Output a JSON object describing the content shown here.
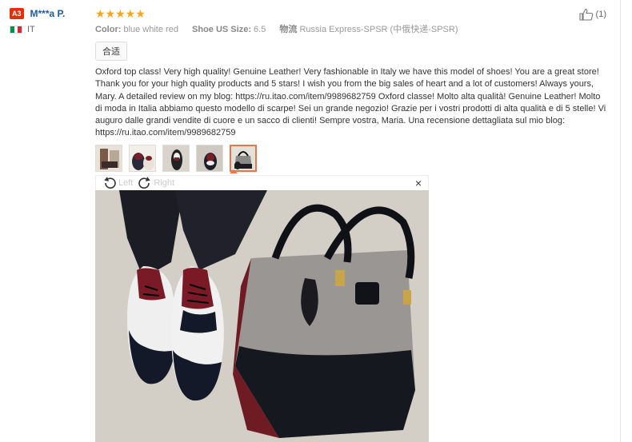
{
  "user": {
    "level_badge": "A3",
    "name": "M***a P.",
    "country": "IT"
  },
  "review": {
    "stars": "★★★★★",
    "color_label": "Color:",
    "color_value": "blue white red",
    "size_label": "Shoe US Size:",
    "size_value": "6.5",
    "shipping_label": "物流",
    "shipping_value": "Russia Express-SPSR (中俄快递-SPSR)",
    "tag": "合适",
    "text": "Oxford top class! Very high quality! Genuine Leather! Very fashionable in Italy we have this model of shoes! You are a great store! Thank you for your high quality products and 5 stars! I wish you from the big sales of heart and a lot of customers! Always yours, Mary. A detailed review on my blog: https://ru.itao.com/item/9989682759 Oxford classe! Molto alta qualità! Genuine Leather! Molto di moda in Italia abbiamo questo modello di scarpe! Sei un grande negozio! Grazie per i vostri prodotti di alta qualità e di 5 stelle! Vi auguro dalle grandi vendite di cuore e un sacco di clienti! Sempre vostra, Maria. Una recensione dettagliata sul mio blog: https://ru.itao.com/item/9989682759",
    "helpful_count": "(1)"
  },
  "viewer": {
    "rotate_left": "Left",
    "rotate_right": "Right",
    "close": "×"
  },
  "colors": {
    "badge_red": "#e62e04",
    "username_blue": "#1a5ba8",
    "star_orange": "#f7a41f",
    "active_thumb_border": "#e8764b",
    "flag_green": "#009246",
    "flag_white": "#ffffff",
    "flag_red": "#ce2b37"
  },
  "icons": {
    "rating": "star-icon",
    "helpful": "thumbs-up-icon",
    "rotate_left": "rotate-left-icon",
    "rotate_right": "rotate-right-icon",
    "close": "close-icon"
  }
}
